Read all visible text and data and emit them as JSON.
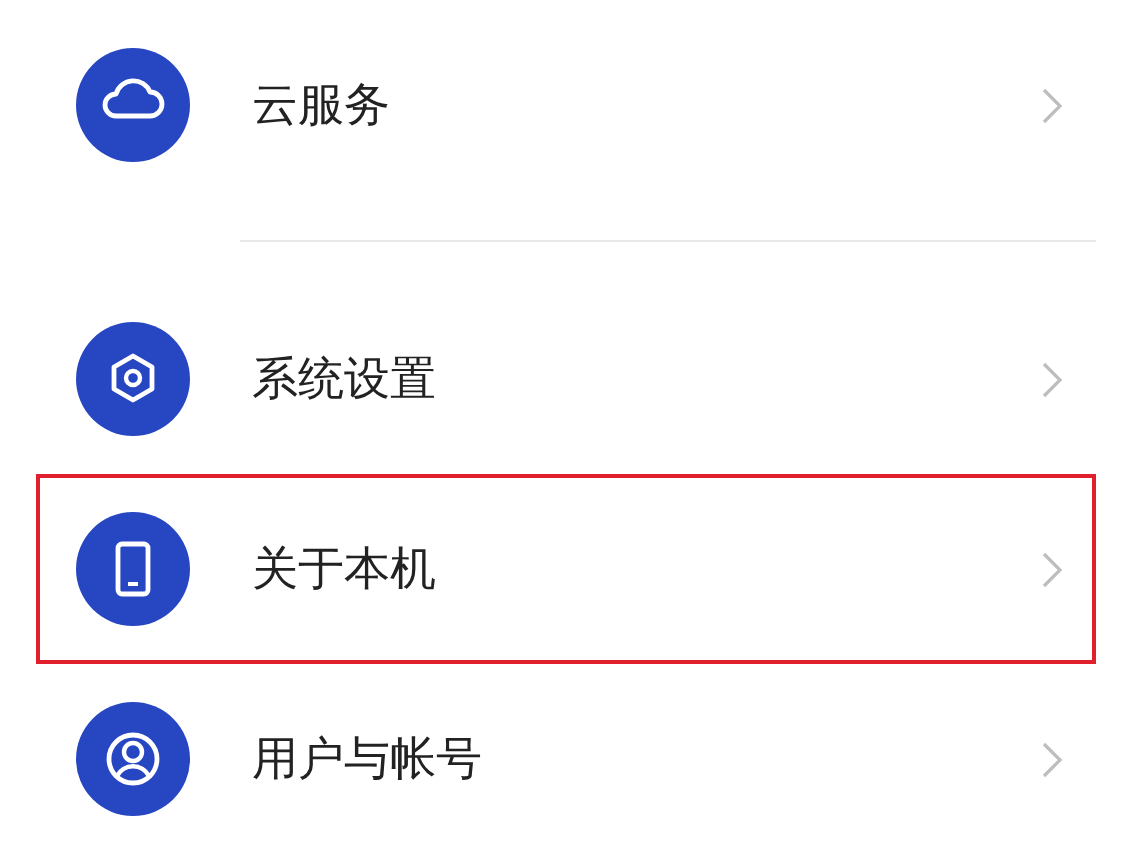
{
  "groups": [
    {
      "items": [
        {
          "label": "云服务",
          "highlighted": false
        }
      ]
    },
    {
      "items": [
        {
          "label": "系统设置",
          "highlighted": false
        },
        {
          "label": "关于本机",
          "highlighted": true
        },
        {
          "label": "用户与帐号",
          "highlighted": false
        }
      ]
    }
  ]
}
